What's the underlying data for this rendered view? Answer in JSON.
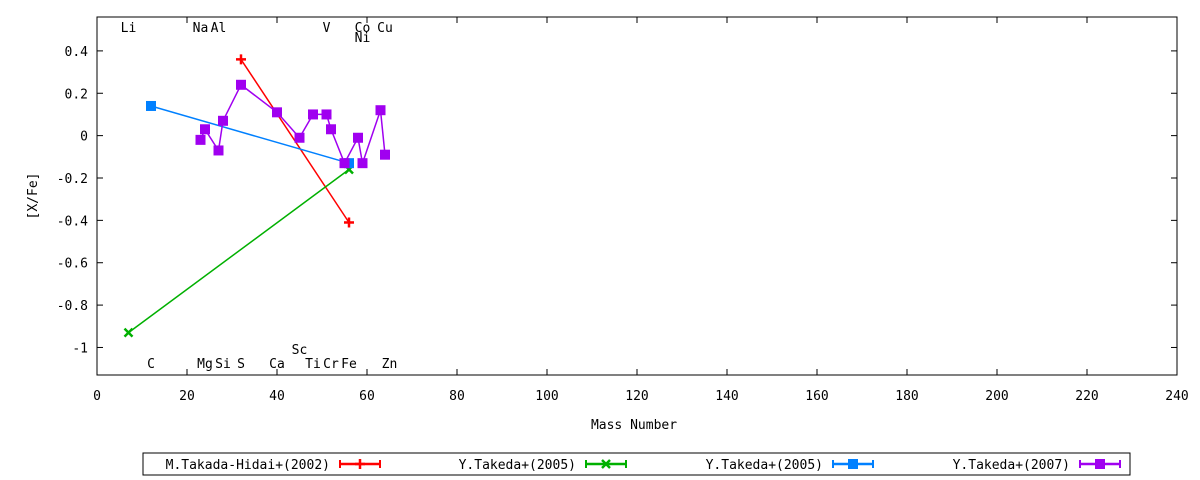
{
  "chart_data": {
    "type": "line",
    "xlabel": "Mass Number",
    "ylabel": "[X/Fe]",
    "xlim": [
      0,
      240
    ],
    "ylim": [
      -1.13,
      0.56
    ],
    "x_ticks": [
      0,
      20,
      40,
      60,
      80,
      100,
      120,
      140,
      160,
      180,
      200,
      220,
      240
    ],
    "y_ticks": [
      0.4,
      0.2,
      0,
      -0.2,
      -0.4,
      -0.6,
      -0.8,
      -1
    ],
    "x_tick_labels": [
      "0",
      "20",
      "40",
      "60",
      "80",
      "100",
      "120",
      "140",
      "160",
      "180",
      "200",
      "220",
      "240"
    ],
    "y_tick_labels": [
      "0.4",
      "0.2",
      "0",
      "-0.2",
      "-0.4",
      "-0.6",
      "-0.8",
      "-1"
    ],
    "grid": false,
    "legend_position": "bottom",
    "series": [
      {
        "name": "M.Takada-Hidai+(2002)",
        "color": "#ff0000",
        "marker": "plus",
        "x": [
          32,
          56
        ],
        "y": [
          0.36,
          -0.41
        ]
      },
      {
        "name": "Y.Takeda+(2005)",
        "color": "#00b000",
        "marker": "cross",
        "x": [
          7,
          56
        ],
        "y": [
          -0.93,
          -0.16
        ]
      },
      {
        "name": "Y.Takeda+(2005)",
        "color": "#0080ff",
        "marker": "square",
        "x": [
          12,
          56
        ],
        "y": [
          0.14,
          -0.13
        ]
      },
      {
        "name": "Y.Takeda+(2007)",
        "color": "#a000f0",
        "marker": "square",
        "x": [
          23,
          24,
          27,
          28,
          32,
          40,
          45,
          48,
          51,
          52,
          55,
          58,
          59,
          63,
          64
        ],
        "y": [
          -0.02,
          0.03,
          -0.07,
          0.07,
          0.24,
          0.11,
          -0.01,
          0.1,
          0.1,
          0.03,
          -0.13,
          -0.01,
          -0.13,
          0.12,
          -0.09
        ]
      }
    ],
    "element_labels_top": [
      {
        "label": "Li",
        "x": 7
      },
      {
        "label": "Na",
        "x": 23
      },
      {
        "label": "Al",
        "x": 27
      },
      {
        "label": "V",
        "x": 51
      },
      {
        "label": "Co",
        "x": 59
      },
      {
        "label": "Cu",
        "x": 64
      },
      {
        "label": "Ni",
        "x": 59,
        "row": 2
      }
    ],
    "element_labels_bottom": [
      {
        "label": "C",
        "x": 12
      },
      {
        "label": "Mg",
        "x": 24
      },
      {
        "label": "Si",
        "x": 28
      },
      {
        "label": "S",
        "x": 32
      },
      {
        "label": "Ca",
        "x": 40
      },
      {
        "label": "Sc",
        "x": 45,
        "row": 2
      },
      {
        "label": "Ti",
        "x": 48
      },
      {
        "label": "Cr",
        "x": 52
      },
      {
        "label": "Fe",
        "x": 56
      },
      {
        "label": "Zn",
        "x": 65
      }
    ]
  }
}
